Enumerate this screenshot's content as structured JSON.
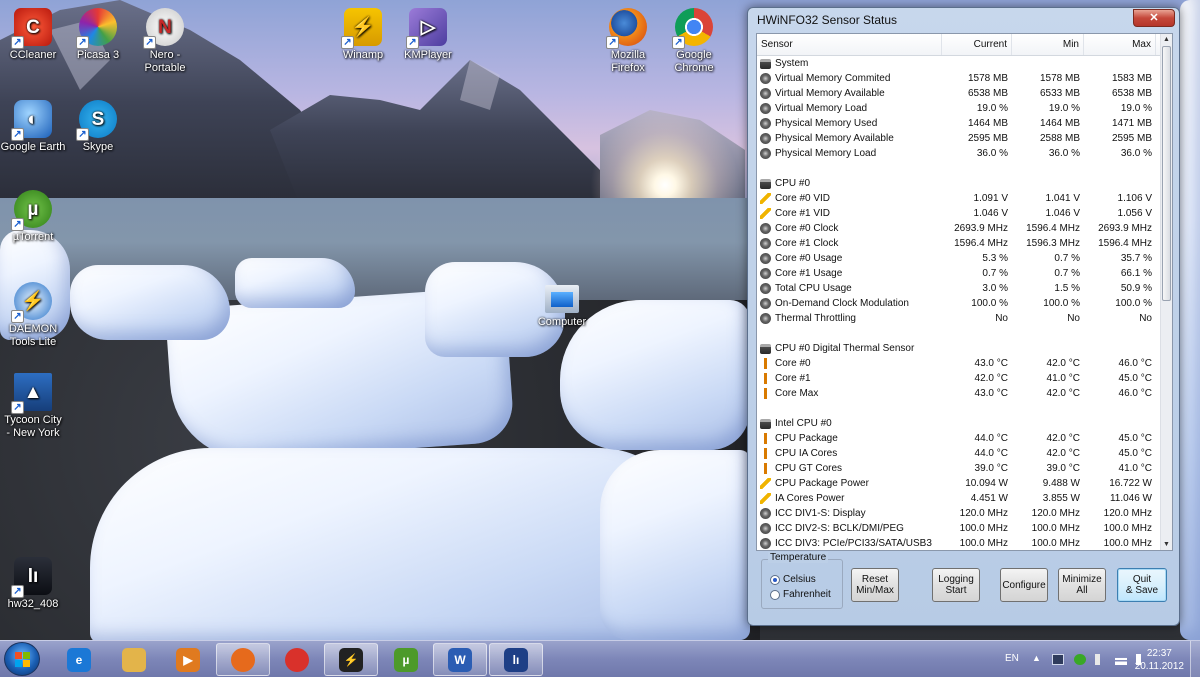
{
  "desktop": {
    "icons": [
      {
        "label_line1": "CCleaner",
        "label_line2": "",
        "icon": "ccleaner-icon"
      },
      {
        "label_line1": "Picasa 3",
        "label_line2": "",
        "icon": "picasa-icon"
      },
      {
        "label_line1": "Nero -",
        "label_line2": "Portable",
        "icon": "nero-icon"
      },
      {
        "label_line1": "Winamp",
        "label_line2": "",
        "icon": "winamp-icon"
      },
      {
        "label_line1": "KMPlayer",
        "label_line2": "",
        "icon": "kmplayer-icon"
      },
      {
        "label_line1": "Mozilla",
        "label_line2": "Firefox",
        "icon": "firefox-icon"
      },
      {
        "label_line1": "Google",
        "label_line2": "Chrome",
        "icon": "chrome-icon"
      },
      {
        "label_line1": "Google Earth",
        "label_line2": "",
        "icon": "google-earth-icon"
      },
      {
        "label_line1": "Skype",
        "label_line2": "",
        "icon": "skype-icon"
      },
      {
        "label_line1": "µTorrent",
        "label_line2": "",
        "icon": "utorrent-icon"
      },
      {
        "label_line1": "DAEMON",
        "label_line2": "Tools Lite",
        "icon": "daemon-tools-icon"
      },
      {
        "label_line1": "Tycoon City",
        "label_line2": "- New York",
        "icon": "tycoon-city-icon"
      },
      {
        "label_line1": "hw32_408",
        "label_line2": "",
        "icon": "hwinfo-icon"
      },
      {
        "label_line1": "Computer",
        "label_line2": "",
        "icon": "computer-icon"
      }
    ]
  },
  "hwinfo": {
    "title": "HWiNFO32 Sensor Status",
    "columns": {
      "sensor": "Sensor",
      "current": "Current",
      "min": "Min",
      "max": "Max"
    },
    "rows": [
      {
        "type": "group",
        "name": "System"
      },
      {
        "type": "gear",
        "name": "Virtual Memory Commited",
        "current": "1578 MB",
        "min": "1578 MB",
        "max": "1583 MB"
      },
      {
        "type": "gear",
        "name": "Virtual Memory Available",
        "current": "6538 MB",
        "min": "6533 MB",
        "max": "6538 MB"
      },
      {
        "type": "gear",
        "name": "Virtual Memory Load",
        "current": "19.0 %",
        "min": "19.0 %",
        "max": "19.0 %"
      },
      {
        "type": "gear",
        "name": "Physical Memory Used",
        "current": "1464 MB",
        "min": "1464 MB",
        "max": "1471 MB"
      },
      {
        "type": "gear",
        "name": "Physical Memory Available",
        "current": "2595 MB",
        "min": "2588 MB",
        "max": "2595 MB"
      },
      {
        "type": "gear",
        "name": "Physical Memory Load",
        "current": "36.0 %",
        "min": "36.0 %",
        "max": "36.0 %"
      },
      {
        "type": "blank"
      },
      {
        "type": "group",
        "name": "CPU #0"
      },
      {
        "type": "volt",
        "name": "Core #0 VID",
        "current": "1.091 V",
        "min": "1.041 V",
        "max": "1.106 V"
      },
      {
        "type": "volt",
        "name": "Core #1 VID",
        "current": "1.046 V",
        "min": "1.046 V",
        "max": "1.056 V"
      },
      {
        "type": "gear",
        "name": "Core #0 Clock",
        "current": "2693.9 MHz",
        "min": "1596.4 MHz",
        "max": "2693.9 MHz"
      },
      {
        "type": "gear",
        "name": "Core #1 Clock",
        "current": "1596.4 MHz",
        "min": "1596.3 MHz",
        "max": "1596.4 MHz"
      },
      {
        "type": "gear",
        "name": "Core #0 Usage",
        "current": "5.3 %",
        "min": "0.7 %",
        "max": "35.7 %"
      },
      {
        "type": "gear",
        "name": "Core #1 Usage",
        "current": "0.7 %",
        "min": "0.7 %",
        "max": "66.1 %"
      },
      {
        "type": "gear",
        "name": "Total CPU Usage",
        "current": "3.0 %",
        "min": "1.5 %",
        "max": "50.9 %"
      },
      {
        "type": "gear",
        "name": "On-Demand Clock Modulation",
        "current": "100.0 %",
        "min": "100.0 %",
        "max": "100.0 %"
      },
      {
        "type": "gear",
        "name": "Thermal Throttling",
        "current": "No",
        "min": "No",
        "max": "No"
      },
      {
        "type": "blank"
      },
      {
        "type": "group",
        "name": "CPU #0 Digital Thermal Sensor"
      },
      {
        "type": "therm",
        "name": "Core #0",
        "current": "43.0 °C",
        "min": "42.0 °C",
        "max": "46.0 °C"
      },
      {
        "type": "therm",
        "name": "Core #1",
        "current": "42.0 °C",
        "min": "41.0 °C",
        "max": "45.0 °C"
      },
      {
        "type": "therm",
        "name": "Core Max",
        "current": "43.0 °C",
        "min": "42.0 °C",
        "max": "46.0 °C"
      },
      {
        "type": "blank"
      },
      {
        "type": "group",
        "name": "Intel CPU #0"
      },
      {
        "type": "therm",
        "name": "CPU Package",
        "current": "44.0 °C",
        "min": "42.0 °C",
        "max": "45.0 °C"
      },
      {
        "type": "therm",
        "name": "CPU IA Cores",
        "current": "44.0 °C",
        "min": "42.0 °C",
        "max": "45.0 °C"
      },
      {
        "type": "therm",
        "name": "CPU GT Cores",
        "current": "39.0 °C",
        "min": "39.0 °C",
        "max": "41.0 °C"
      },
      {
        "type": "volt",
        "name": "CPU Package Power",
        "current": "10.094 W",
        "min": "9.488 W",
        "max": "16.722 W"
      },
      {
        "type": "volt",
        "name": "IA Cores Power",
        "current": "4.451 W",
        "min": "3.855 W",
        "max": "11.046 W"
      },
      {
        "type": "gear",
        "name": "ICC DIV1-S: Display",
        "current": "120.0 MHz",
        "min": "120.0 MHz",
        "max": "120.0 MHz"
      },
      {
        "type": "gear",
        "name": "ICC DIV2-S: BCLK/DMI/PEG",
        "current": "100.0 MHz",
        "min": "100.0 MHz",
        "max": "100.0 MHz"
      },
      {
        "type": "gear",
        "name": "ICC DIV3: PCIe/PCI33/SATA/USB3",
        "current": "100.0 MHz",
        "min": "100.0 MHz",
        "max": "100.0 MHz"
      }
    ],
    "temperature": {
      "legend": "Temperature",
      "celsius": "Celsius",
      "fahrenheit": "Fahrenheit",
      "selected": "Celsius"
    },
    "buttons": {
      "reset": {
        "line1": "Reset",
        "line2": "Min/Max"
      },
      "logging": {
        "line1": "Logging",
        "line2": "Start"
      },
      "configure": {
        "line1": "Configure",
        "line2": ""
      },
      "minimize_all": {
        "line1": "Minimize",
        "line2": "All"
      },
      "quit": {
        "line1": "Quit",
        "line2": "& Save"
      }
    },
    "close_glyph": "✕"
  },
  "taskbar": {
    "apps": [
      {
        "name": "internet-explorer",
        "glyph": "e",
        "color": "#1b78d6",
        "active": false
      },
      {
        "name": "windows-explorer",
        "glyph": "",
        "color": "#e3b44a",
        "active": false
      },
      {
        "name": "media-player",
        "glyph": "▶",
        "color": "#e07a1f",
        "active": false
      },
      {
        "name": "firefox",
        "glyph": "",
        "color": "#e66a1c",
        "active": true
      },
      {
        "name": "chrome",
        "glyph": "",
        "color": "#d9312b",
        "active": false
      },
      {
        "name": "winamp",
        "glyph": "⚡",
        "color": "#222222",
        "active": true
      },
      {
        "name": "utorrent",
        "glyph": "µ",
        "color": "#4d9a2a",
        "active": false
      },
      {
        "name": "word",
        "glyph": "W",
        "color": "#2b5db3",
        "active": true
      },
      {
        "name": "hwinfo",
        "glyph": "lı",
        "color": "#1e3f86",
        "active": true
      }
    ],
    "language": "EN",
    "time": "22:37",
    "date": "20.11.2012"
  }
}
